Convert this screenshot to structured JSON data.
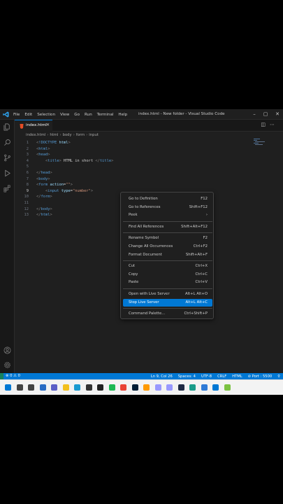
{
  "window": {
    "title": "index.html - New folder - Visual Studio Code",
    "menu": [
      "File",
      "Edit",
      "Selection",
      "View",
      "Go",
      "Run",
      "Terminal",
      "Help"
    ],
    "controls": [
      "–",
      "▢",
      "✕"
    ]
  },
  "tab": {
    "label": "index.html",
    "close": "✕"
  },
  "breadcrumb": [
    "index.html",
    "html",
    "body",
    "form",
    "input"
  ],
  "editor": {
    "lines": [
      {
        "n": "1",
        "html": "<span class='p'>&lt;</span><span class='t'>!DOCTYPE</span> <span class='a'>html</span><span class='p'>&gt;</span>"
      },
      {
        "n": "2",
        "html": "<span class='p'>&lt;</span><span class='t'>html</span><span class='p'>&gt;</span>"
      },
      {
        "n": "3",
        "html": "<span class='p'>&lt;</span><span class='t'>head</span><span class='p'>&gt;</span>"
      },
      {
        "n": "4",
        "html": "    <span class='p'>&lt;</span><span class='t'>title</span><span class='p'>&gt;</span> HTML in short <span class='p'>&lt;/</span><span class='t'>title</span><span class='p'>&gt;</span>"
      },
      {
        "n": "5",
        "html": ""
      },
      {
        "n": "6",
        "html": "<span class='p'>&lt;/</span><span class='t'>head</span><span class='p'>&gt;</span>"
      },
      {
        "n": "7",
        "html": "<span class='p'>&lt;</span><span class='t'>body</span><span class='p'>&gt;</span>"
      },
      {
        "n": "8",
        "html": "<span class='p'>&lt;</span><span class='t'>form</span> <span class='a'>action</span>=<span class='s'>\"\"</span><span class='p'>&gt;</span>"
      },
      {
        "n": "9",
        "html": "    <span class='p'>&lt;</span><span class='t'>input</span> <span class='a'>type</span>=<span class='s'>\"number\"</span><span class='p'>&gt;</span>"
      },
      {
        "n": "10",
        "html": "<span class='p'>&lt;/</span><span class='t'>form</span><span class='p'>&gt;</span>"
      },
      {
        "n": "11",
        "html": ""
      },
      {
        "n": "12",
        "html": "<span class='p'>&lt;/</span><span class='t'>body</span><span class='p'>&gt;</span>"
      },
      {
        "n": "13",
        "html": "<span class='p'>&lt;/</span><span class='t'>html</span><span class='p'>&gt;</span>"
      }
    ]
  },
  "context_menu": {
    "groups": [
      [
        {
          "label": "Go to Definition",
          "key": "F12"
        },
        {
          "label": "Go to References",
          "key": "Shift+F12"
        },
        {
          "label": "Peek",
          "key": "›"
        }
      ],
      [
        {
          "label": "Find All References",
          "key": "Shift+Alt+F12"
        }
      ],
      [
        {
          "label": "Rename Symbol",
          "key": "F2"
        },
        {
          "label": "Change All Occurrences",
          "key": "Ctrl+F2"
        },
        {
          "label": "Format Document",
          "key": "Shift+Alt+F"
        }
      ],
      [
        {
          "label": "Cut",
          "key": "Ctrl+X"
        },
        {
          "label": "Copy",
          "key": "Ctrl+C"
        },
        {
          "label": "Paste",
          "key": "Ctrl+V"
        }
      ],
      [
        {
          "label": "Open with Live Server",
          "key": "Alt+L Alt+O"
        },
        {
          "label": "Stop Live Server",
          "key": "Alt+L Alt+C",
          "active": true
        }
      ],
      [
        {
          "label": "Command Palette...",
          "key": "Ctrl+Shift+P"
        }
      ]
    ]
  },
  "statusbar": {
    "problems": "⊗ 0 ⚠ 0",
    "right": [
      "Ln 9, Col 26",
      "Spaces: 4",
      "UTF-8",
      "CRLF",
      "HTML",
      "⊘ Port : 5500",
      "⚲"
    ]
  },
  "taskbar": {
    "icons": [
      {
        "name": "windows-start-icon",
        "color": "#0078d4"
      },
      {
        "name": "search-icon",
        "color": "#444444"
      },
      {
        "name": "task-view-icon",
        "color": "#444444"
      },
      {
        "name": "widgets-icon",
        "color": "#2a6cc4"
      },
      {
        "name": "chat-icon",
        "color": "#5b5fc7"
      },
      {
        "name": "file-explorer-icon",
        "color": "#f2c01e"
      },
      {
        "name": "edge-icon",
        "color": "#1b9bd1"
      },
      {
        "name": "store-icon",
        "color": "#333333"
      },
      {
        "name": "app-icon",
        "color": "#222222"
      },
      {
        "name": "green-app-icon",
        "color": "#1db954"
      },
      {
        "name": "chrome-icon",
        "color": "#e94335"
      },
      {
        "name": "photoshop-icon",
        "color": "#001e36"
      },
      {
        "name": "illustrator-icon",
        "color": "#ff9a00"
      },
      {
        "name": "after-effects-icon",
        "color": "#9999ff"
      },
      {
        "name": "premiere-icon",
        "color": "#9999ff"
      },
      {
        "name": "media-encoder-icon",
        "color": "#1f2a44"
      },
      {
        "name": "audio-app-icon",
        "color": "#1a9c8a"
      },
      {
        "name": "photos-icon",
        "color": "#2f7ad6"
      },
      {
        "name": "vscode-icon",
        "color": "#0078d4"
      },
      {
        "name": "lime-app-icon",
        "color": "#7cc242"
      }
    ]
  },
  "colors": {
    "accent": "#0078d4",
    "editor_bg": "#1f1f1f",
    "statusbar": "#0078d4"
  }
}
